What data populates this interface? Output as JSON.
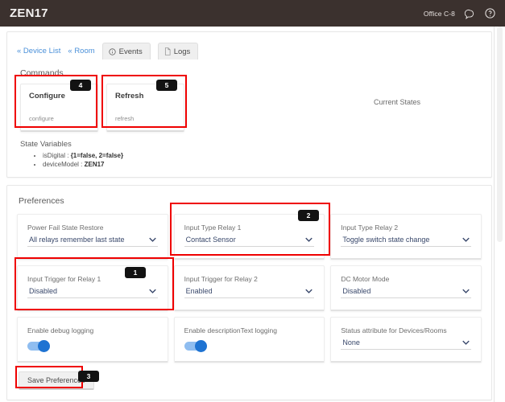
{
  "topbar": {
    "title": "ZEN17",
    "location": "Office C-8",
    "chat_icon": "speech-bubble-icon",
    "help_icon": "help-circle-icon"
  },
  "breadcrumbs": [
    {
      "label": "« Device List"
    },
    {
      "label": "« Room"
    }
  ],
  "tabs": [
    {
      "label": "Events",
      "icon": "info-circle-icon"
    },
    {
      "label": "Logs",
      "icon": "document-icon"
    }
  ],
  "commands": {
    "heading": "Commands",
    "items": [
      {
        "title": "Configure",
        "subtitle": "configure"
      },
      {
        "title": "Refresh",
        "subtitle": "refresh"
      }
    ]
  },
  "current_states": {
    "heading": "Current States"
  },
  "state_variables": {
    "heading": "State Variables",
    "items": [
      {
        "key": "isDigital : ",
        "value": "{1=false, 2=false}"
      },
      {
        "key": "deviceModel : ",
        "value": "ZEN17"
      }
    ]
  },
  "preferences": {
    "heading": "Preferences",
    "fields": [
      {
        "label": "Power Fail State Restore",
        "value": "All relays remember last state",
        "type": "select"
      },
      {
        "label": "Input Type Relay 1",
        "value": "Contact Sensor",
        "type": "select"
      },
      {
        "label": "Input Type Relay 2",
        "value": "Toggle switch state change",
        "type": "select"
      },
      {
        "label": "Input Trigger for Relay 1",
        "value": "Disabled",
        "type": "select"
      },
      {
        "label": "Input Trigger for Relay 2",
        "value": "Enabled",
        "type": "select"
      },
      {
        "label": "DC Motor Mode",
        "value": "Disabled",
        "type": "select"
      },
      {
        "label": "Enable debug logging",
        "value": "on",
        "type": "toggle"
      },
      {
        "label": "Enable descriptionText logging",
        "value": "on",
        "type": "toggle"
      },
      {
        "label": "Status attribute for Devices/Rooms",
        "value": "None",
        "type": "select"
      }
    ],
    "save_label": "Save Preferences"
  },
  "annotations": {
    "accent_color": "#ef0000",
    "badges": [
      {
        "number": "1"
      },
      {
        "number": "2"
      },
      {
        "number": "3"
      },
      {
        "number": "4"
      },
      {
        "number": "5"
      }
    ]
  }
}
